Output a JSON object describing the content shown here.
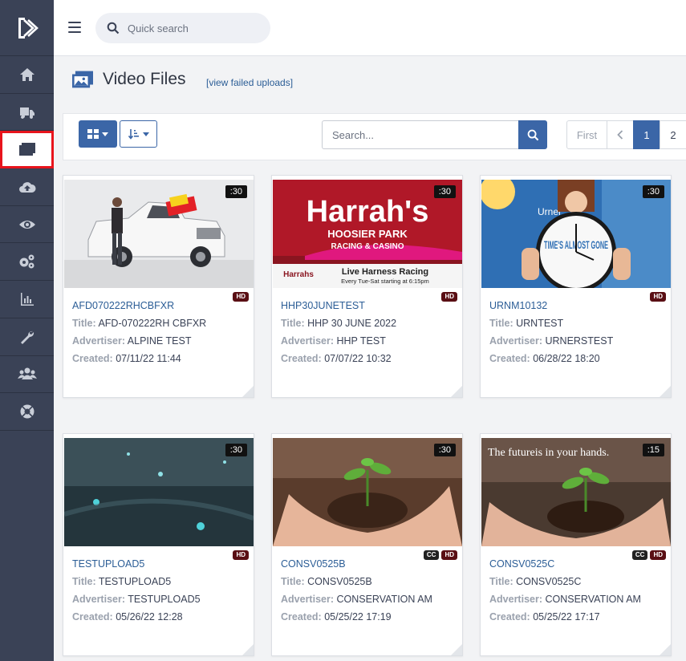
{
  "topbar": {
    "search_placeholder": "Quick search"
  },
  "page": {
    "title": "Video Files",
    "failed_link": "[view failed uploads]"
  },
  "toolbar": {
    "search_placeholder": "Search...",
    "pager": {
      "first": "First",
      "prev": "‹",
      "pages": [
        "1",
        "2"
      ]
    }
  },
  "labels": {
    "title": "Title:",
    "advertiser": "Advertiser:",
    "created": "Created:"
  },
  "sidebar": {
    "items": [
      {
        "icon": "home-icon"
      },
      {
        "icon": "truck-icon"
      },
      {
        "icon": "video-files-icon",
        "active": true
      },
      {
        "icon": "upload-cloud-icon"
      },
      {
        "icon": "eye-icon"
      },
      {
        "icon": "gears-icon"
      },
      {
        "icon": "bar-chart-icon"
      },
      {
        "icon": "wrench-icon"
      },
      {
        "icon": "users-icon"
      },
      {
        "icon": "lifesaver-icon"
      }
    ]
  },
  "cards": [
    {
      "name": "AFD070222RHCBFXR",
      "title": "AFD-070222RH CBFXR",
      "advertiser": "ALPINE TEST",
      "created": "07/11/22 11:44",
      "duration": ":30",
      "badges": [
        "HD"
      ]
    },
    {
      "name": "HHP30JUNETEST",
      "title": "HHP 30 JUNE 2022",
      "advertiser": "HHP TEST",
      "created": "07/07/22 10:32",
      "duration": ":30",
      "badges": [
        "HD"
      ],
      "thumb_text": {
        "brand": "Harrah's",
        "line1": "HOOSIER PARK",
        "line2": "RACING & CASINO",
        "small": "Harrahs",
        "banner": "Live Harness Racing",
        "sub": "Every Tue-Sat starting at 6:15pm"
      }
    },
    {
      "name": "URNM10132",
      "title": "URNTEST",
      "advertiser": "URNERSTEST",
      "created": "06/28/22 18:20",
      "duration": ":30",
      "badges": [
        "HD"
      ],
      "thumb_text": {
        "clock_text": "TIME'S ALMOST GONE",
        "sign": "Urner"
      }
    },
    {
      "name": "TESTUPLOAD5",
      "title": "TESTUPLOAD5",
      "advertiser": "TESTUPLOAD5",
      "created": "05/26/22 12:28",
      "duration": ":30",
      "badges": [
        "HD"
      ]
    },
    {
      "name": "CONSV0525B",
      "title": "CONSV0525B",
      "advertiser": "CONSERVATION AM",
      "created": "05/25/22 17:19",
      "duration": ":30",
      "badges": [
        "CC",
        "HD"
      ]
    },
    {
      "name": "CONSV0525C",
      "title": "CONSV0525C",
      "advertiser": "CONSERVATION AM",
      "created": "05/25/22 17:17",
      "duration": ":15",
      "badges": [
        "CC",
        "HD"
      ],
      "thumb_text": {
        "caption": "The futureis in your hands."
      }
    }
  ]
}
